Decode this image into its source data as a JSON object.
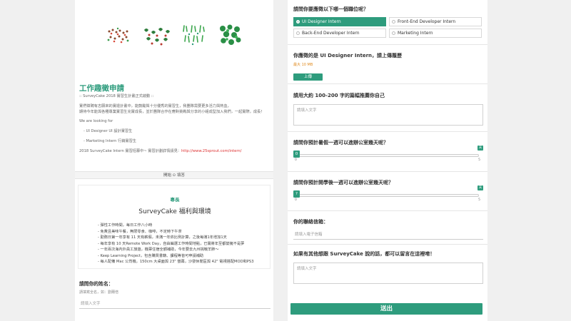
{
  "left": {
    "title": "工作趣徵申請",
    "intro": ":: SurveyCake 2018 實習生計畫正式啟動 ::",
    "para1": "實們徵聘有志願來的實證計畫中，能鼓勵與十分優秀的實習生，我團隊需要更多活力與熱血，",
    "para2": "期待今年能與各種專業實習生充實成長，並於團隊合作在應對挑戰與分享的小組成型加入我們，一起實際，成長！",
    "looking": "We are looking for",
    "item1": "- UI Designer UI 設計實習生",
    "item2": "- Marketing Intern 行銷實習生",
    "site_prefix": "2018 SurveyCake Intern 實習招募中~ 實習計劃詳情請見：",
    "site_url": "http://www.25sprout.com/intern/",
    "start_bar": "開始 ⊙ 填答",
    "card_kicker": "專長",
    "card_title": "SurveyCake 福利與環境",
    "benefits": [
      "- 彈性工作時間，每日工作八小時",
      "- 免費且美味午餐，無限零食、咖啡，不定時下午茶",
      "- 勤務日第一年享有 11 天有薪假，未滿一年依比例計算，之後每滿1年增加1天",
      "- 每年享有 10 天Remote Work Day，自由編選工作時間地點，已實將年至都變擁不是夢",
      "- 一年兩次海內外員工旅遊，機票住宿全額補助，今年要去九州挑戰羊肺～",
      "- Keep Learning Project，包含購買書籍、課程等皆可申請補助",
      "- 每人配備 Mac 公司機，150cm 大桌面與 23\" 螢幕，沙發休閒區與 42\" 電視搭配MOD和PS3"
    ],
    "name_question": "請問你的姓名：",
    "name_hint": "請填寫全名，如：劉爾倍",
    "name_placeholder": "請填入文字"
  },
  "right": {
    "position_question": "請問你要應徵以下哪一個職位呢？",
    "options": [
      "UI Designer Intern",
      "Front-End Developer Intern",
      "Back-End Developer Intern",
      "Marketing Intern"
    ],
    "selected_option": "UI Designer Intern",
    "resume_question": "你應徵的是 UI Designer Intern，請上傳履歷",
    "resume_size": "最大 10 MB",
    "upload_label": "上傳",
    "intro_question": "請用大約 100-200 字的篇幅推薦你自己",
    "intro_placeholder": "請填入文字",
    "slider1_question": "請問你預計暑假一週可以進辦公室幾天呢？",
    "slider1_value": "0",
    "slider1_min": "0",
    "slider1_max": "5",
    "slider1_badge": "天",
    "slider2_question": "請問你預計開學後一週可以進辦公室幾天呢？",
    "slider2_value": "?",
    "slider2_min": "0",
    "slider2_max": "5",
    "slider2_badge": "天",
    "email_question": "你的聯絡信箱：",
    "email_placeholder": "請填入電子信箱",
    "message_question": "如果有其他想跟 SurveyCake 說的話，都可以留言在這裡唷！",
    "message_placeholder": "請填入文字",
    "submit_label": "送出"
  },
  "colors": {
    "accent": "#2e9c7d",
    "warning": "#e08a1e",
    "link": "#dd3333"
  }
}
